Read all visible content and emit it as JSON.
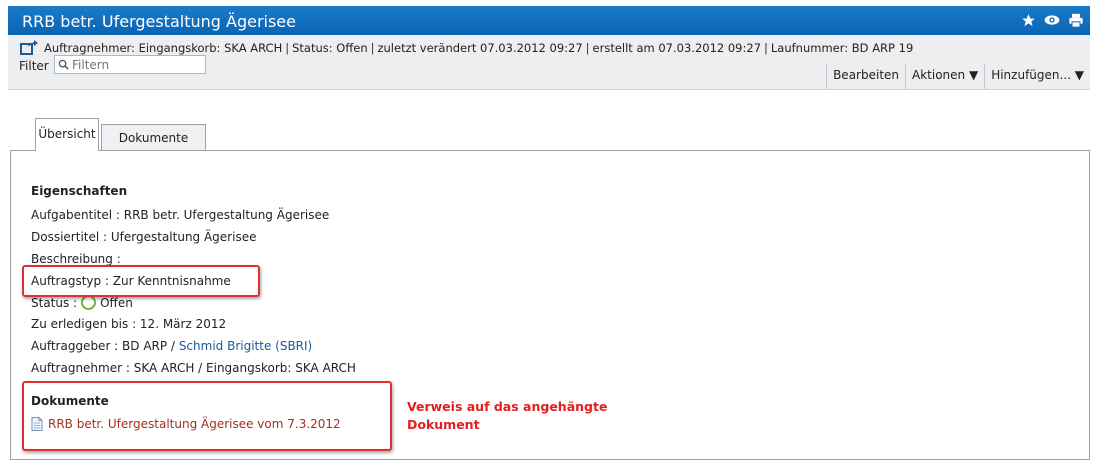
{
  "window": {
    "title": "RRB betr. Ufergestaltung Ägerisee",
    "icons": [
      "star-icon",
      "eye-icon",
      "print-icon"
    ]
  },
  "info": {
    "auftragnehmer": "Auftragnehmer: Eingangskorb: SKA ARCH",
    "status": "Status:  Offen",
    "modified": "zuletzt verändert 07.03.2012 09:27",
    "created": "erstellt am 07.03.2012 09:27",
    "number": "Laufnummer: BD ARP 19"
  },
  "filter": {
    "label": "Filter",
    "placeholder": "Filtern"
  },
  "toolbar": {
    "edit": "Bearbeiten",
    "actions": "Aktionen ▼",
    "add": "Hinzufügen... ▼"
  },
  "tabs": [
    {
      "label": "Übersicht",
      "active": true
    },
    {
      "label": "Dokumente",
      "active": false
    }
  ],
  "properties": {
    "heading": "Eigenschaften",
    "aufgabentitel": "Aufgabentitel : RRB betr. Ufergestaltung Ägerisee",
    "dossiertitel": "Dossiertitel : Ufergestaltung Ägerisee",
    "beschreibung": "Beschreibung :",
    "auftragstyp": "Auftragstyp : Zur Kenntnisnahme",
    "status_label": "Status :",
    "status_value": "Offen",
    "status_color": "#6db33f",
    "erledigen": "Zu erledigen bis : 12. März 2012",
    "auftraggeber_label": "Auftraggeber : BD ARP /",
    "auftraggeber_link": "Schmid Brigitte (SBRI)",
    "auftragnehmer": "Auftragnehmer : SKA ARCH / Eingangskorb: SKA ARCH"
  },
  "documents": {
    "heading": "Dokumente",
    "items": [
      {
        "label": "RRB betr. Ufergestaltung Ägerisee vom 7.3.2012",
        "icon": "document-icon"
      }
    ]
  },
  "annotation": {
    "line1": "Verweis auf das angehängte",
    "line2": "Dokument",
    "color": "#e02020"
  }
}
